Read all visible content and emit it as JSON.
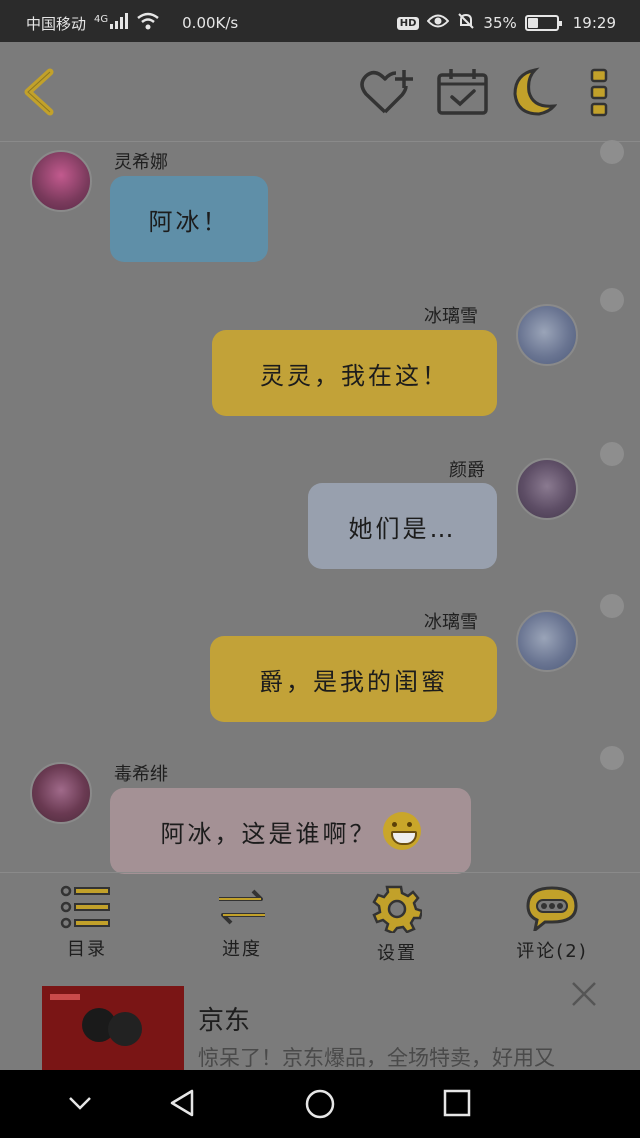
{
  "status_bar": {
    "carrier": "中国移动",
    "network": "4G",
    "speed": "0.00K/s",
    "hd": "HD",
    "battery_text": "35%",
    "battery_level": 0.35,
    "time": "19:29"
  },
  "toolbar": {
    "icons": [
      "back-icon",
      "add-favorite-icon",
      "calendar-check-icon",
      "night-mode-moon-icon",
      "more-vertical-icon"
    ],
    "accent_color": "#c2a12a"
  },
  "messages": [
    {
      "name": "灵希娜",
      "text": "阿冰！",
      "side": "left",
      "color": "#5f8fa8"
    },
    {
      "name": "冰璃雪",
      "text": "灵灵，我在这！",
      "side": "right",
      "color": "#c2a238"
    },
    {
      "name": "颜爵",
      "text": "她们是…",
      "side": "right",
      "color": "#98a0ae"
    },
    {
      "name": "冰璃雪",
      "text": "爵，是我的闺蜜",
      "side": "right",
      "color": "#c2a238"
    },
    {
      "name": "毒希绯",
      "text": "阿冰，这是谁啊？",
      "side": "left",
      "color": "#a49195",
      "emoji": "grinning-face-icon"
    }
  ],
  "bottom_nav": [
    {
      "label": "目录",
      "icon": "list-icon"
    },
    {
      "label": "进度",
      "icon": "swap-arrows-icon"
    },
    {
      "label": "设置",
      "icon": "gear-icon"
    },
    {
      "label": "评论(2)",
      "icon": "comment-bubble-icon"
    }
  ],
  "ad": {
    "title": "京东",
    "description": "惊呆了！京东爆品，全场特卖，好用又"
  }
}
